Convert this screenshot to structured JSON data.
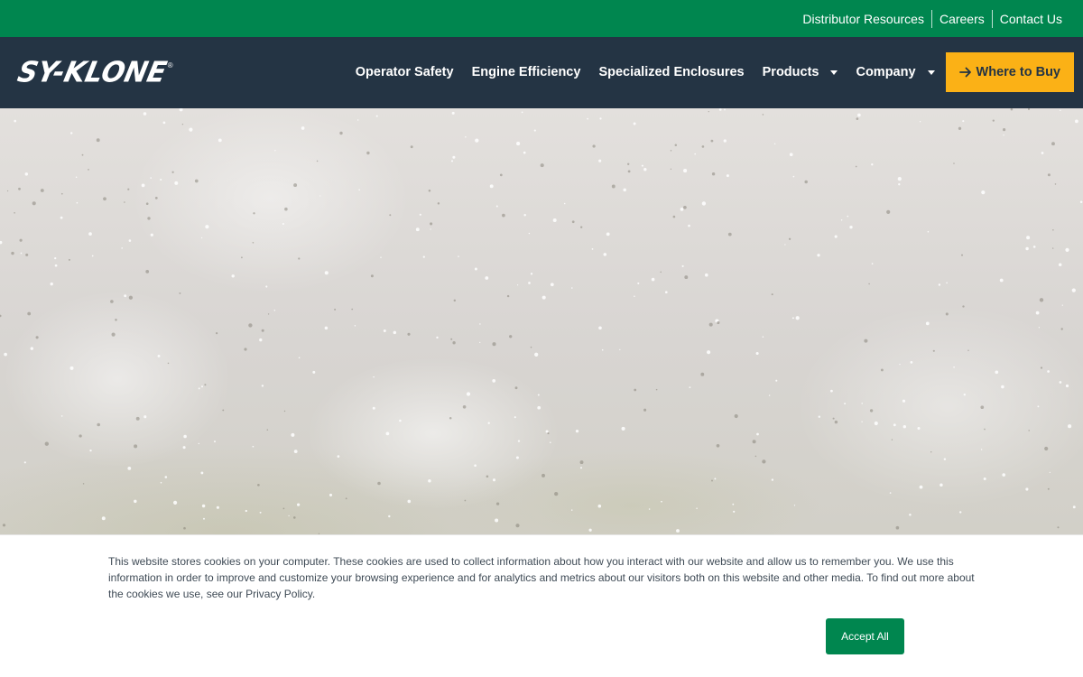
{
  "utility_bar": {
    "links": [
      "Distributor Resources",
      "Careers",
      "Contact Us"
    ]
  },
  "brand": {
    "logo_text": "SY-KLONE",
    "logo_mark": "®"
  },
  "nav": {
    "items": [
      {
        "label": "Operator Safety",
        "has_dropdown": false
      },
      {
        "label": "Engine Efficiency",
        "has_dropdown": false
      },
      {
        "label": "Specialized Enclosures",
        "has_dropdown": false
      },
      {
        "label": "Products",
        "has_dropdown": true
      },
      {
        "label": "Company",
        "has_dropdown": true
      }
    ],
    "cta_label": "Where to Buy",
    "cta_icon": "arrow-right-icon"
  },
  "hero": {
    "image": "dust-cloud-background"
  },
  "cookie_banner": {
    "text": "This website stores cookies on your computer. These cookies are used to collect information about how you interact with our website and allow us to remember you. We use this information in order to improve and customize your browsing experience and for analytics and metrics about our visitors both on this website and other media. To find out more about the cookies we use, see our Privacy Policy.",
    "accept_label": "Accept All"
  },
  "colors": {
    "utility_bar_bg": "#00864f",
    "nav_bg": "#243444",
    "cta_bg": "#fbb116",
    "accept_bg": "#00864f"
  }
}
